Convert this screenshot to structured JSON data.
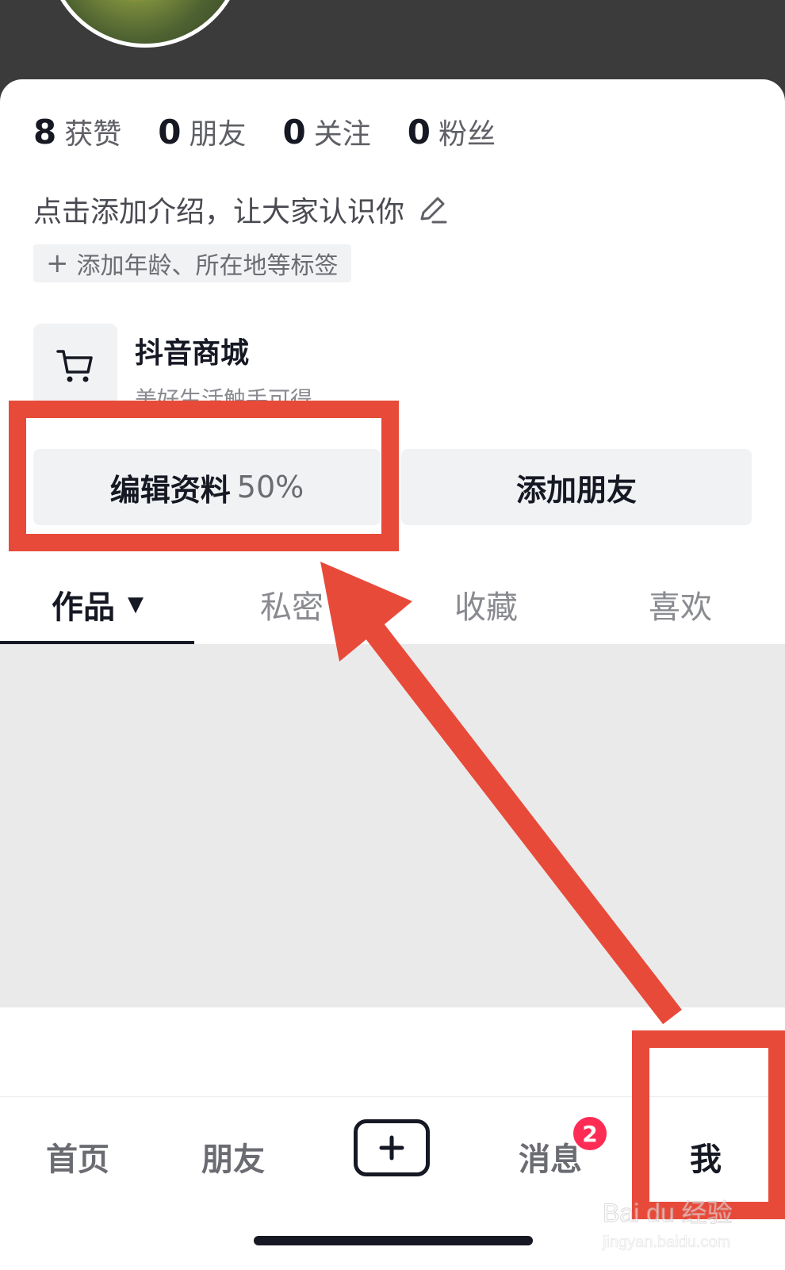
{
  "profile": {
    "stats": [
      {
        "num": "8",
        "label": "获赞"
      },
      {
        "num": "0",
        "label": "朋友"
      },
      {
        "num": "0",
        "label": "关注"
      },
      {
        "num": "0",
        "label": "粉丝"
      }
    ],
    "intro": "点击添加介绍，让大家认识你",
    "tag_chip": "添加年龄、所在地等标签"
  },
  "shop": {
    "title": "抖音商城",
    "subtitle": "美好生活触手可得"
  },
  "actions": {
    "edit_label": "编辑资料",
    "edit_percent": "50%",
    "add_friend_label": "添加朋友"
  },
  "tabs": [
    {
      "label": "作品",
      "active": true
    },
    {
      "label": "私密"
    },
    {
      "label": "收藏"
    },
    {
      "label": "喜欢"
    }
  ],
  "bottom_nav": {
    "home": "首页",
    "friends": "朋友",
    "create_icon": "plus-square-icon",
    "messages": "消息",
    "messages_badge": "2",
    "me": "我"
  },
  "annotation": {
    "highlight_color": "#e84a3a"
  },
  "watermark": {
    "brand": "Bai du 经验",
    "url": "jingyan.baidu.com"
  }
}
